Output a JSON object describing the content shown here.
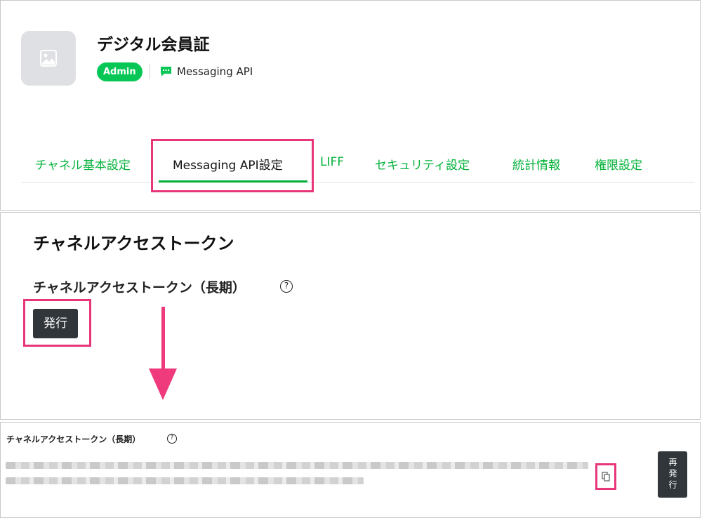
{
  "channel": {
    "name": "デジタル会員証",
    "role_badge": "Admin",
    "type_label": "Messaging API"
  },
  "tabs": [
    {
      "label": "チャネル基本設定"
    },
    {
      "label": "Messaging API設定",
      "active": true
    },
    {
      "label": "LIFF"
    },
    {
      "label": "セキュリティ設定"
    },
    {
      "label": "統計情報"
    },
    {
      "label": "権限設定"
    }
  ],
  "token_section": {
    "title": "チャネルアクセストークン",
    "subtitle": "チャネルアクセストークン（長期）",
    "help_glyph": "?",
    "issue_button": "発行"
  },
  "result_section": {
    "label": "チャネルアクセストークン（長期）",
    "help_glyph": "?",
    "reissue_button": "再発行"
  },
  "colors": {
    "brand_green": "#06c755",
    "tab_green": "#06b23c",
    "highlight_pink": "#e8367a",
    "dark_button": "#30363a"
  }
}
